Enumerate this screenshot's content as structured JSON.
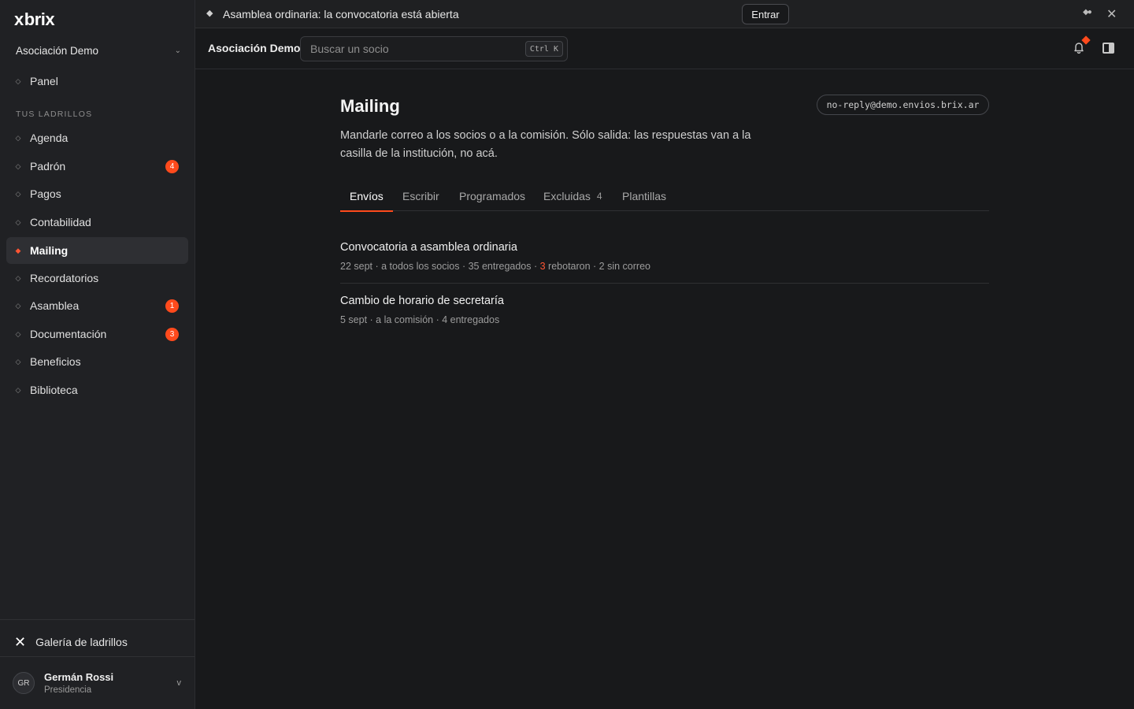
{
  "sidebar": {
    "logo": "brix",
    "logo_prefix": "x",
    "org_name": "Asociación Demo",
    "panel_label": "Panel",
    "section_label": "TUS LADRILLOS",
    "items": [
      {
        "label": "Agenda"
      },
      {
        "label": "Padrón",
        "badge": "4"
      },
      {
        "label": "Pagos"
      },
      {
        "label": "Contabilidad"
      },
      {
        "label": "Mailing",
        "active": true
      },
      {
        "label": "Recordatorios"
      },
      {
        "label": "Asamblea",
        "badge": "1"
      },
      {
        "label": "Documentación",
        "badge": "3"
      },
      {
        "label": "Beneficios"
      },
      {
        "label": "Biblioteca"
      }
    ],
    "gallery_label": "Galería de ladrillos",
    "user": {
      "initials": "GR",
      "name": "Germán Rossi",
      "role": "Presidencia"
    }
  },
  "announcement": {
    "text": "Asamblea ordinaria: la convocatoria está abierta",
    "button": "Entrar"
  },
  "header": {
    "org_name": "Asociación Demo",
    "search_placeholder": "Buscar un socio",
    "shortcut": "Ctrl K"
  },
  "main": {
    "title": "Mailing",
    "sender": "no-reply@demo.envios.brix.ar",
    "description": "Mandarle correo a los socios o a la comisión. Sólo salida: las respuestas van a la casilla de la institución, no acá.",
    "tabs": [
      {
        "label": "Envíos",
        "active": true
      },
      {
        "label": "Escribir"
      },
      {
        "label": "Programados"
      },
      {
        "label": "Excluidas",
        "count": "4"
      },
      {
        "label": "Plantillas"
      }
    ],
    "mailings": [
      {
        "title": "Convocatoria a asamblea ordinaria",
        "meta_before": "22 sept · a todos los socios · 35 entregados · ",
        "bounced": "3",
        "meta_after": " rebotaron · 2 sin correo"
      },
      {
        "title": "Cambio de horario de secretaría",
        "meta_before": "5 sept · a la comisión · 4 entregados",
        "bounced": "",
        "meta_after": ""
      }
    ]
  },
  "colors": {
    "accent": "#ff4a1c",
    "background": "#18191b",
    "sidebar": "#202124"
  }
}
